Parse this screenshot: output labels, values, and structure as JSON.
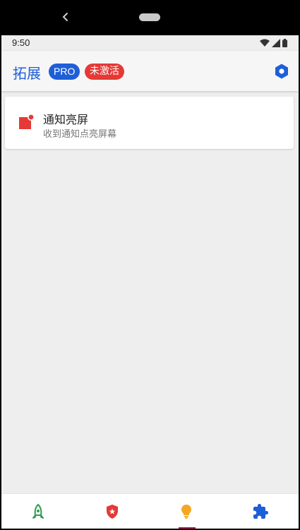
{
  "status_bar": {
    "time": "9:50"
  },
  "app_bar": {
    "title": "拓展",
    "badge_pro": "PRO",
    "badge_status": "未激活"
  },
  "extensions": [
    {
      "title": "通知亮屏",
      "subtitle": "收到通知点亮屏幕"
    }
  ],
  "colors": {
    "accent_blue": "#1e5ed8",
    "accent_red": "#e53935",
    "rocket_green": "#2e9d4f",
    "bulb_yellow": "#f5a623",
    "indicator": "#c2185b"
  },
  "bottom_nav": {
    "items": [
      {
        "icon": "rocket-icon"
      },
      {
        "icon": "shield-star-icon"
      },
      {
        "icon": "lightbulb-icon",
        "selected": true
      },
      {
        "icon": "puzzle-icon"
      }
    ]
  }
}
